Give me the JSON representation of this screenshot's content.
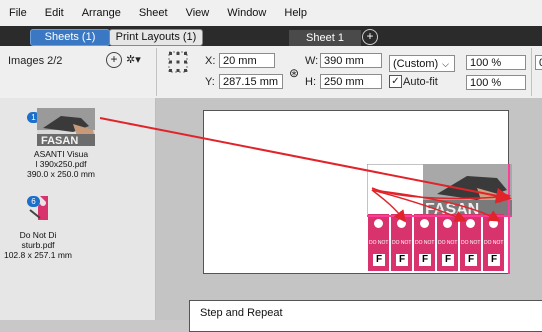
{
  "menu": [
    "File",
    "Edit",
    "Arrange",
    "Sheet",
    "View",
    "Window",
    "Help"
  ],
  "tabs": {
    "sheets": "Sheets (1)",
    "print_layouts": "Print Layouts (1)",
    "sheet1": "Sheet 1",
    "add": "+"
  },
  "toolbar": {
    "images_label": "Images 2/2",
    "add": "+",
    "gear": "✲▾",
    "x_label": "X:",
    "x_value": "20 mm",
    "y_label": "Y:",
    "y_value": "287.15 mm",
    "w_label": "W:",
    "w_value": "390 mm",
    "h_label": "H:",
    "h_value": "250 mm",
    "link": "⊛",
    "size_preset": "(Custom)",
    "autofit_check": "✓",
    "autofit_label": "Auto-fit",
    "scale_w": "100 %",
    "scale_h": "100 %",
    "extra": "0"
  },
  "images": [
    {
      "badge": "1",
      "name": "ASANTI Visua",
      "file": "l 390x250.pdf",
      "size": "390.0 x 250.0 mm",
      "art_text": "FASAN"
    },
    {
      "badge": "6",
      "name": "Do Not Di",
      "file": "sturb.pdf",
      "size": "102.8 x 257.1 mm"
    }
  ],
  "placed_art_text": "FASAN",
  "hangers": [
    {
      "top": "DO NOT",
      "letter": "F"
    },
    {
      "top": "DO NOT",
      "letter": "F"
    },
    {
      "top": "DO NOT",
      "letter": "F"
    },
    {
      "top": "DO NOT",
      "letter": "F"
    },
    {
      "top": "DO NOT",
      "letter": "F"
    },
    {
      "top": "DO NOT",
      "letter": "F"
    }
  ],
  "dialog_title": "Step and Repeat",
  "colors": {
    "accent": "#3a78c4",
    "arrow": "#e0242a",
    "tag": "#d8336c",
    "selection": "#ff3b9a"
  }
}
